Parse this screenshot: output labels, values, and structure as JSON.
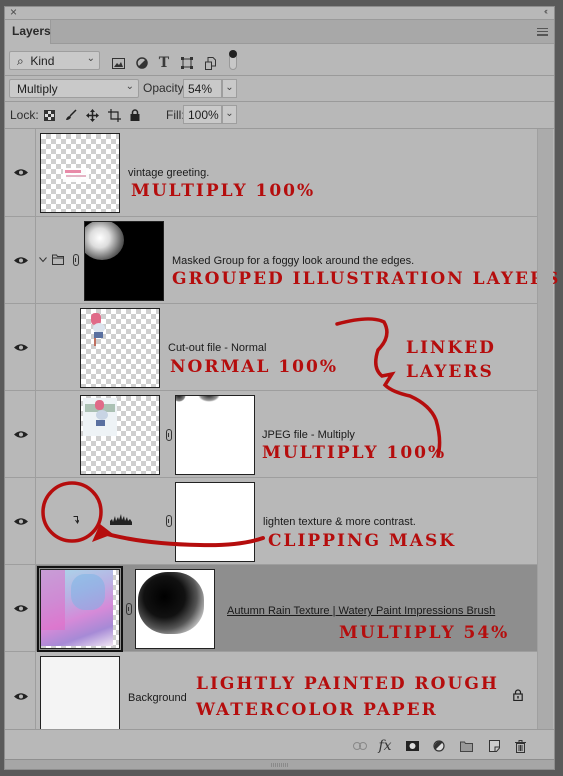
{
  "panel": {
    "close_glyph": "×",
    "collapse_glyph": "‹‹",
    "tab_label": "Layers",
    "menu_icon": "panel-menu-icon"
  },
  "filter": {
    "kind_label": "Kind",
    "icons": [
      "pixel-filter-icon",
      "adjustment-filter-icon",
      "type-filter-icon",
      "shape-filter-icon",
      "smart-object-filter-icon",
      "filter-toggle-icon"
    ]
  },
  "blend": {
    "mode": "Multiply",
    "opacity_label": "Opacity:",
    "opacity_value": "54%"
  },
  "lock": {
    "label": "Lock:",
    "icons": [
      "lock-transparent-icon",
      "lock-image-icon",
      "lock-position-icon",
      "lock-artboard-icon",
      "lock-all-icon"
    ],
    "fill_label": "Fill:",
    "fill_value": "100%"
  },
  "layers": [
    {
      "name": "vintage greeting.",
      "annotation": "MULTIPLY 100%",
      "visible": true
    },
    {
      "name": "Masked Group for a foggy look around the edges.",
      "annotation": "GROUPED ILLUSTRATION LAYERS",
      "visible": true,
      "type": "group",
      "expanded": true
    },
    {
      "name": "Cut-out file - Normal",
      "annotation": "NORMAL 100%",
      "visible": true
    },
    {
      "name": "JPEG file - Multiply",
      "annotation": "MULTIPLY 100%",
      "visible": true,
      "linked": true
    },
    {
      "name": "lighten texture & more contrast.",
      "annotation": "CLIPPING MASK",
      "visible": true,
      "type": "levels-adjustment",
      "clipped": true
    },
    {
      "name": "Autumn Rain Texture | Watery Paint Impressions Brush",
      "annotation": "MULTIPLY 54%",
      "visible": true,
      "selected": true
    },
    {
      "name": "Background",
      "annotation_line1": "LIGHTLY PAINTED ROUGH",
      "annotation_line2": "WATERCOLOR PAPER",
      "visible": true,
      "locked": true
    }
  ],
  "side_annotation": {
    "line1": "LINKED",
    "line2": "LAYERS"
  },
  "footer": {
    "icons": [
      "link-layers-icon",
      "fx-icon",
      "add-mask-icon",
      "adjustment-layer-icon",
      "new-group-icon",
      "new-layer-icon",
      "delete-layer-icon"
    ],
    "fx_label": "fx"
  },
  "colors": {
    "annotation": "#b50d0d",
    "panel": "#b8b8b8",
    "selected_row": "#8e8e8e"
  }
}
